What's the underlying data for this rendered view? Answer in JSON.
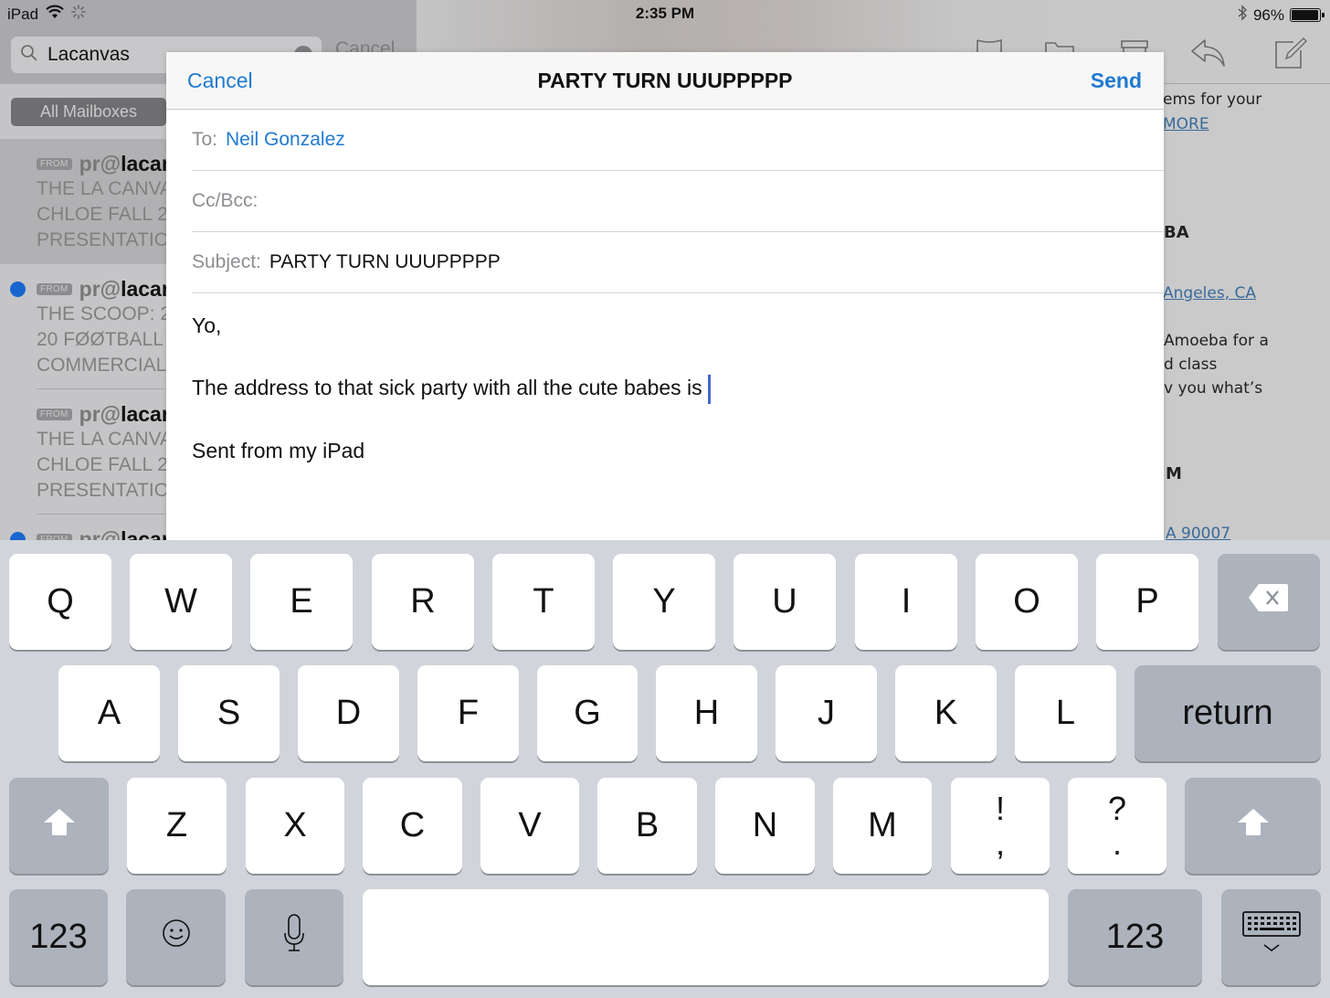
{
  "status_bar": {
    "device": "iPad",
    "time": "2:35 PM",
    "battery": "96%",
    "battery_level": 0.96
  },
  "mail_backdrop": {
    "search": {
      "value": "Lacanvas",
      "cancel_label": "Cancel"
    },
    "scope_button": "All Mailboxes",
    "messages": [
      {
        "badge": "FROM",
        "from_prefix": "pr@",
        "from_bold": "lacan",
        "lines": [
          "THE LA CANVA",
          "CHLOE FALL 2",
          "PRESENTATIO"
        ],
        "unread": false,
        "selected": true
      },
      {
        "badge": "FROM",
        "from_prefix": "pr@",
        "from_bold": "lacan",
        "lines": [
          "THE SCOOP: 2",
          "20 FØØTBALL",
          "COMMERCIAL"
        ],
        "unread": true,
        "selected": false
      },
      {
        "badge": "FROM",
        "from_prefix": "pr@",
        "from_bold": "lacan",
        "lines": [
          "THE LA CANVA",
          "CHLOE FALL 2",
          "PRESENTATIO"
        ],
        "unread": false,
        "selected": false
      },
      {
        "badge": "FROM",
        "from_prefix": "pr@",
        "from_bold": "lacan",
        "lines": [],
        "unread": true,
        "selected": false
      }
    ],
    "detail_fragments": {
      "line1": "ems for your",
      "more_link": "MORE",
      "heading1": "BA",
      "location_link": "Angeles, CA",
      "para1": "Amoeba for a",
      "para2": "d class",
      "para3": "v you what’s",
      "heading2": "M",
      "zip_link": "A 90007"
    },
    "toolbar_icons": [
      "flag-icon",
      "folder-icon",
      "archive-icon",
      "reply-icon",
      "compose-icon"
    ]
  },
  "compose": {
    "cancel_label": "Cancel",
    "title": "PARTY TURN UUUPPPPP",
    "send_label": "Send",
    "to_label": "To:",
    "to_value": "Neil Gonzalez",
    "ccbcc_label": "Cc/Bcc:",
    "ccbcc_value": "",
    "subject_label": "Subject:",
    "subject_value": "PARTY TURN UUUPPPPP",
    "body": {
      "greeting": "Yo,",
      "line": "The address to that sick party with all the cute babes is",
      "signature": "Sent from my iPad"
    }
  },
  "keyboard": {
    "row1": [
      "Q",
      "W",
      "E",
      "R",
      "T",
      "Y",
      "U",
      "I",
      "O",
      "P"
    ],
    "row2": [
      "A",
      "S",
      "D",
      "F",
      "G",
      "H",
      "J",
      "K",
      "L"
    ],
    "row3": [
      "Z",
      "X",
      "C",
      "V",
      "B",
      "N",
      "M"
    ],
    "punct1": {
      "top": "!",
      "bottom": ","
    },
    "punct2": {
      "top": "?",
      "bottom": "."
    },
    "return_label": "return",
    "numbers_label": "123",
    "delete_icon": "delete-icon",
    "shift_icon": "shift-icon",
    "emoji_icon": "emoji-icon",
    "mic_icon": "microphone-icon",
    "dismiss_icon": "keyboard-dismiss-icon"
  },
  "colors": {
    "accent": "#1f7ad1",
    "unread_dot": "#1a66d0",
    "caret": "#4466cc",
    "keyboard_bg": "#d1d5db",
    "func_key": "#acb3bd"
  }
}
